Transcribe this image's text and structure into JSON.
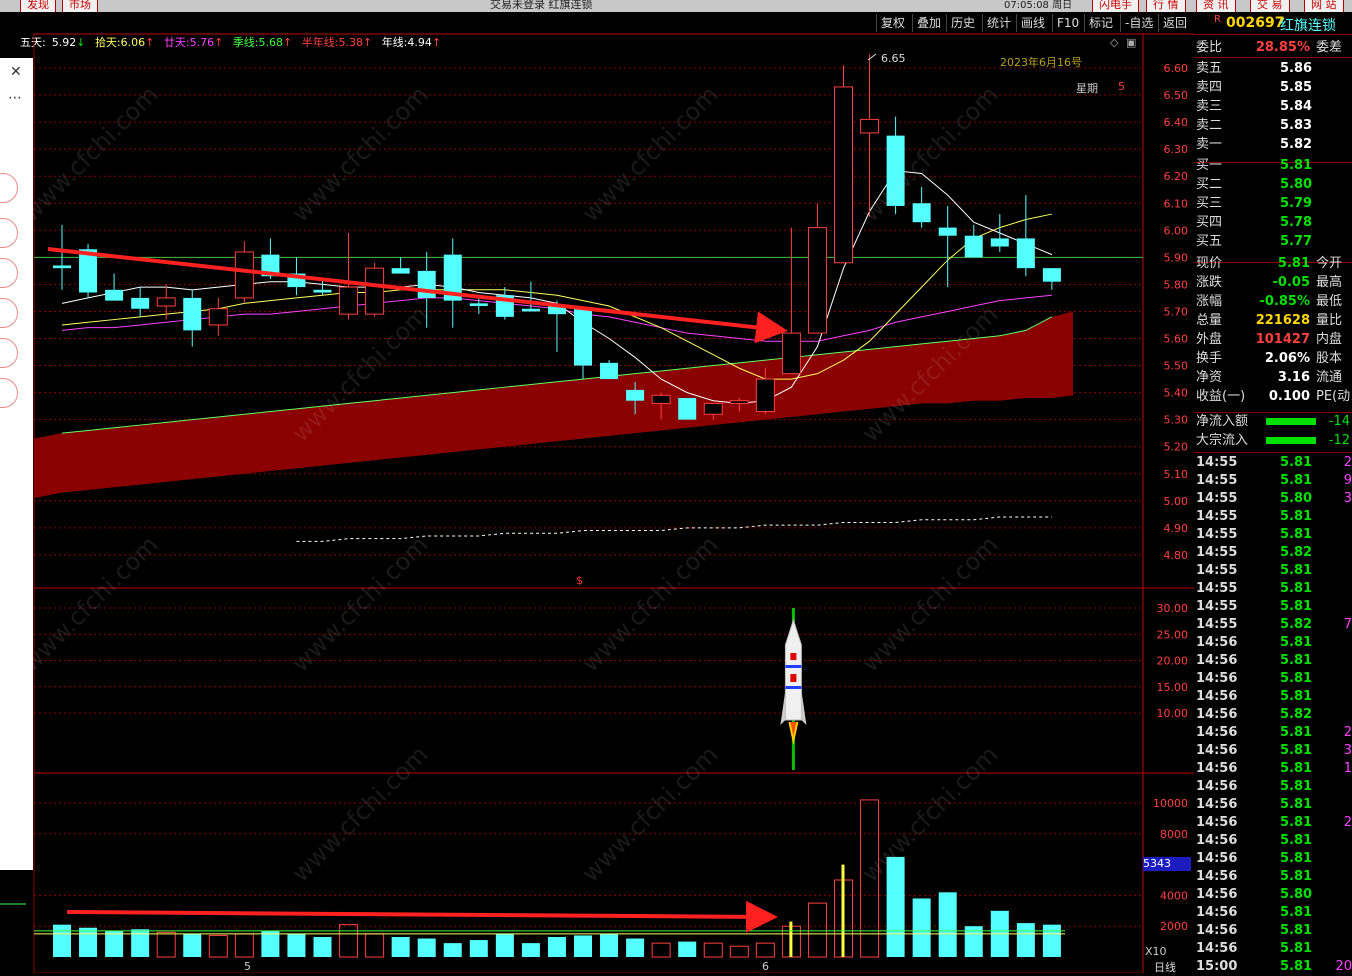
{
  "topbar": {
    "left_buttons": [
      "发现",
      "市场"
    ],
    "title": "交易未登录  红旗连锁",
    "time": "07:05:08 周日",
    "right_buttons": [
      "闪电手",
      "行 情",
      "资 讯",
      "交 易",
      "网 站"
    ]
  },
  "toolbar": {
    "buttons": [
      "复权",
      "叠加",
      "历史",
      "统计",
      "画线",
      "F10",
      "标记",
      "-自选",
      "返回"
    ]
  },
  "ma_legend": [
    {
      "label": "五天:",
      "value": "5.92",
      "arrow": "↓",
      "color": "#ffffff"
    },
    {
      "label": "拾天:",
      "value": "6.06",
      "arrow": "↑",
      "color": "#ffff60"
    },
    {
      "label": "廿天:",
      "value": "5.76",
      "arrow": "↑",
      "color": "#ff40ff"
    },
    {
      "label": "季线:",
      "value": "5.68",
      "arrow": "↑",
      "color": "#40ff40"
    },
    {
      "label": "半年线:",
      "value": "5.38",
      "arrow": "↑",
      "color": "#ff4040"
    },
    {
      "label": "年线:",
      "value": "4.94",
      "arrow": "↑",
      "color": "#ffffff"
    }
  ],
  "chart_info": {
    "date": "2023年6月16号",
    "weekday_label": "星期",
    "weekday_value": "5",
    "high_marker": "6.65",
    "dollar_marker": "$",
    "watermark": "www.cfchi.com",
    "vol_scale_badge": "5343",
    "vol_multiplier": "X10",
    "x_labels": [
      "5",
      "6"
    ],
    "period": "日线"
  },
  "price_axis": [
    "6.60",
    "6.50",
    "6.40",
    "6.30",
    "6.20",
    "6.10",
    "6.00",
    "5.90",
    "5.80",
    "5.70",
    "5.60",
    "5.50",
    "5.40",
    "5.30",
    "5.20",
    "5.10",
    "5.00",
    "4.90",
    "4.80"
  ],
  "ind_axis": [
    "30.00",
    "25.00",
    "20.00",
    "15.00",
    "10.00"
  ],
  "vol_axis": [
    "10000",
    "8000",
    "4000",
    "2000"
  ],
  "colors": {
    "up": "#ff4040",
    "down": "#54ffff",
    "grid": "#8b0000",
    "band": "#8b0000",
    "arrow": "#ff2020"
  },
  "chart_data": {
    "type": "candlestick",
    "candles": [
      {
        "o": 5.87,
        "h": 6.02,
        "l": 5.78,
        "c": 5.86
      },
      {
        "o": 5.93,
        "h": 5.95,
        "l": 5.75,
        "c": 5.77
      },
      {
        "o": 5.78,
        "h": 5.84,
        "l": 5.75,
        "c": 5.74
      },
      {
        "o": 5.75,
        "h": 5.79,
        "l": 5.68,
        "c": 5.71
      },
      {
        "o": 5.72,
        "h": 5.8,
        "l": 5.67,
        "c": 5.75
      },
      {
        "o": 5.75,
        "h": 5.78,
        "l": 5.57,
        "c": 5.63
      },
      {
        "o": 5.65,
        "h": 5.75,
        "l": 5.61,
        "c": 5.71
      },
      {
        "o": 5.75,
        "h": 5.96,
        "l": 5.73,
        "c": 5.92
      },
      {
        "o": 5.91,
        "h": 5.97,
        "l": 5.82,
        "c": 5.83
      },
      {
        "o": 5.84,
        "h": 5.9,
        "l": 5.76,
        "c": 5.79
      },
      {
        "o": 5.78,
        "h": 5.82,
        "l": 5.76,
        "c": 5.77
      },
      {
        "o": 5.69,
        "h": 5.99,
        "l": 5.67,
        "c": 5.79
      },
      {
        "o": 5.69,
        "h": 5.88,
        "l": 5.68,
        "c": 5.86
      },
      {
        "o": 5.86,
        "h": 5.9,
        "l": 5.84,
        "c": 5.84
      },
      {
        "o": 5.85,
        "h": 5.92,
        "l": 5.64,
        "c": 5.75
      },
      {
        "o": 5.91,
        "h": 5.97,
        "l": 5.64,
        "c": 5.74
      },
      {
        "o": 5.73,
        "h": 5.75,
        "l": 5.69,
        "c": 5.72
      },
      {
        "o": 5.76,
        "h": 5.79,
        "l": 5.67,
        "c": 5.68
      },
      {
        "o": 5.71,
        "h": 5.81,
        "l": 5.7,
        "c": 5.7
      },
      {
        "o": 5.72,
        "h": 5.74,
        "l": 5.55,
        "c": 5.69
      },
      {
        "o": 5.71,
        "h": 5.71,
        "l": 5.45,
        "c": 5.5
      },
      {
        "o": 5.51,
        "h": 5.52,
        "l": 5.45,
        "c": 5.45
      },
      {
        "o": 5.41,
        "h": 5.44,
        "l": 5.32,
        "c": 5.37
      },
      {
        "o": 5.36,
        "h": 5.4,
        "l": 5.3,
        "c": 5.39
      },
      {
        "o": 5.38,
        "h": 5.38,
        "l": 5.31,
        "c": 5.3
      },
      {
        "o": 5.32,
        "h": 5.36,
        "l": 5.3,
        "c": 5.36
      },
      {
        "o": 5.36,
        "h": 5.38,
        "l": 5.33,
        "c": 5.37
      },
      {
        "o": 5.33,
        "h": 5.49,
        "l": 5.32,
        "c": 5.45
      },
      {
        "o": 5.47,
        "h": 6.01,
        "l": 5.47,
        "c": 5.62
      },
      {
        "o": 5.62,
        "h": 6.1,
        "l": 5.62,
        "c": 6.01
      },
      {
        "o": 5.88,
        "h": 6.61,
        "l": 5.88,
        "c": 6.53
      },
      {
        "o": 6.36,
        "h": 6.65,
        "l": 6.05,
        "c": 6.41
      },
      {
        "o": 6.35,
        "h": 6.42,
        "l": 6.06,
        "c": 6.09
      },
      {
        "o": 6.1,
        "h": 6.16,
        "l": 6.01,
        "c": 6.03
      },
      {
        "o": 6.01,
        "h": 6.09,
        "l": 5.79,
        "c": 5.98
      },
      {
        "o": 5.98,
        "h": 6.02,
        "l": 5.9,
        "c": 5.9
      },
      {
        "o": 5.97,
        "h": 6.06,
        "l": 5.92,
        "c": 5.94
      },
      {
        "o": 5.97,
        "h": 6.13,
        "l": 5.83,
        "c": 5.86
      },
      {
        "o": 5.86,
        "h": 5.86,
        "l": 5.78,
        "c": 5.81
      }
    ],
    "ma5": [
      5.73,
      5.75,
      5.77,
      5.79,
      5.79,
      5.78,
      5.79,
      5.8,
      5.81,
      5.81,
      5.8,
      5.79,
      5.79,
      5.79,
      5.8,
      5.79,
      5.77,
      5.76,
      5.75,
      5.73,
      5.66,
      5.6,
      5.53,
      5.45,
      5.4,
      5.37,
      5.36,
      5.37,
      5.42,
      5.57,
      5.86,
      6.07,
      6.22,
      6.21,
      6.13,
      6.03,
      5.99,
      5.95,
      5.91
    ],
    "ma10": [
      5.65,
      5.66,
      5.67,
      5.68,
      5.69,
      5.7,
      5.71,
      5.73,
      5.74,
      5.75,
      5.76,
      5.77,
      5.77,
      5.78,
      5.78,
      5.78,
      5.78,
      5.78,
      5.77,
      5.76,
      5.74,
      5.72,
      5.68,
      5.64,
      5.59,
      5.54,
      5.49,
      5.45,
      5.45,
      5.47,
      5.52,
      5.59,
      5.69,
      5.79,
      5.89,
      5.97,
      6.01,
      6.04,
      6.06
    ],
    "ma20": [
      5.63,
      5.64,
      5.64,
      5.65,
      5.66,
      5.67,
      5.68,
      5.69,
      5.69,
      5.7,
      5.71,
      5.72,
      5.73,
      5.74,
      5.75,
      5.75,
      5.74,
      5.73,
      5.72,
      5.71,
      5.69,
      5.68,
      5.66,
      5.64,
      5.62,
      5.61,
      5.6,
      5.59,
      5.59,
      5.59,
      5.61,
      5.63,
      5.66,
      5.68,
      5.7,
      5.72,
      5.74,
      5.75,
      5.76
    ],
    "ma60": [
      5.25,
      5.26,
      5.27,
      5.28,
      5.29,
      5.3,
      5.31,
      5.32,
      5.33,
      5.34,
      5.35,
      5.36,
      5.37,
      5.38,
      5.39,
      5.4,
      5.41,
      5.42,
      5.43,
      5.44,
      5.45,
      5.46,
      5.47,
      5.48,
      5.49,
      5.5,
      5.51,
      5.52,
      5.53,
      5.54,
      5.55,
      5.56,
      5.57,
      5.58,
      5.59,
      5.6,
      5.61,
      5.63,
      5.68
    ],
    "ma120": [
      5.03,
      5.04,
      5.05,
      5.06,
      5.07,
      5.08,
      5.09,
      5.1,
      5.11,
      5.12,
      5.13,
      5.14,
      5.15,
      5.16,
      5.17,
      5.18,
      5.19,
      5.2,
      5.21,
      5.22,
      5.23,
      5.24,
      5.25,
      5.26,
      5.27,
      5.28,
      5.29,
      5.3,
      5.31,
      5.32,
      5.33,
      5.34,
      5.35,
      5.36,
      5.36,
      5.37,
      5.37,
      5.38,
      5.38
    ],
    "ma250_start_index": 9,
    "ma250": [
      4.85,
      4.85,
      4.86,
      4.86,
      4.86,
      4.87,
      4.87,
      4.87,
      4.88,
      4.88,
      4.88,
      4.89,
      4.89,
      4.89,
      4.89,
      4.9,
      4.9,
      4.9,
      4.91,
      4.91,
      4.91,
      4.92,
      4.92,
      4.92,
      4.93,
      4.93,
      4.93,
      4.94,
      4.94,
      4.94
    ],
    "volumes": [
      2100,
      1900,
      1700,
      1800,
      1600,
      1500,
      1400,
      1500,
      1700,
      1500,
      1300,
      2100,
      1500,
      1300,
      1200,
      900,
      1100,
      1500,
      900,
      1300,
      1400,
      1500,
      1200,
      900,
      1000,
      900,
      700,
      900,
      2000,
      3500,
      5000,
      10200,
      6500,
      3800,
      4200,
      2000,
      3000,
      2200,
      2100
    ],
    "vol_ma_baseline": 1700,
    "vol_highlight": [
      {
        "index": 28,
        "value": 2300
      },
      {
        "index": 30,
        "value": 6000
      }
    ],
    "rocket_index": 28
  },
  "quote": {
    "code": "002697",
    "name": "红旗连锁",
    "weibi_label": "委比",
    "weibi": "28.85%",
    "weicha_label": "委差",
    "asks": [
      {
        "label": "卖五",
        "price": "5.86"
      },
      {
        "label": "卖四",
        "price": "5.85"
      },
      {
        "label": "卖三",
        "price": "5.84"
      },
      {
        "label": "卖二",
        "price": "5.83"
      },
      {
        "label": "卖一",
        "price": "5.82"
      }
    ],
    "bids": [
      {
        "label": "买一",
        "price": "5.81"
      },
      {
        "label": "买二",
        "price": "5.80"
      },
      {
        "label": "买三",
        "price": "5.79"
      },
      {
        "label": "买四",
        "price": "5.78"
      },
      {
        "label": "买五",
        "price": "5.77"
      }
    ],
    "stats": [
      {
        "l1": "现价",
        "v": "5.81",
        "l2": "今开",
        "c": "g"
      },
      {
        "l1": "涨跌",
        "v": "-0.05",
        "l2": "最高",
        "c": "g"
      },
      {
        "l1": "涨幅",
        "v": "-0.85%",
        "l2": "最低",
        "c": "g"
      },
      {
        "l1": "总量",
        "v": "221628",
        "l2": "量比",
        "c": "y"
      },
      {
        "l1": "外盘",
        "v": "101427",
        "l2": "内盘",
        "c": "r"
      },
      {
        "l1": "换手",
        "v": "2.06%",
        "l2": "股本",
        "c": "w"
      },
      {
        "l1": "净资",
        "v": "3.16",
        "l2": "流通",
        "c": "w"
      },
      {
        "l1": "收益(一)",
        "v": "0.100",
        "l2": "PE(动",
        "c": "w"
      }
    ],
    "flows": [
      {
        "label": "净流入额",
        "val": "-14"
      },
      {
        "label": "大宗流入",
        "val": "-12"
      }
    ],
    "ticks": [
      {
        "t": "14:55",
        "p": "5.81",
        "v": "2"
      },
      {
        "t": "14:55",
        "p": "5.81",
        "v": "9"
      },
      {
        "t": "14:55",
        "p": "5.80",
        "v": "3"
      },
      {
        "t": "14:55",
        "p": "5.81",
        "v": ""
      },
      {
        "t": "14:55",
        "p": "5.81",
        "v": ""
      },
      {
        "t": "14:55",
        "p": "5.82",
        "v": ""
      },
      {
        "t": "14:55",
        "p": "5.81",
        "v": ""
      },
      {
        "t": "14:55",
        "p": "5.81",
        "v": ""
      },
      {
        "t": "14:55",
        "p": "5.81",
        "v": ""
      },
      {
        "t": "14:55",
        "p": "5.82",
        "v": "7"
      },
      {
        "t": "14:56",
        "p": "5.81",
        "v": ""
      },
      {
        "t": "14:56",
        "p": "5.81",
        "v": ""
      },
      {
        "t": "14:56",
        "p": "5.81",
        "v": ""
      },
      {
        "t": "14:56",
        "p": "5.81",
        "v": ""
      },
      {
        "t": "14:56",
        "p": "5.82",
        "v": ""
      },
      {
        "t": "14:56",
        "p": "5.81",
        "v": "2"
      },
      {
        "t": "14:56",
        "p": "5.81",
        "v": "3"
      },
      {
        "t": "14:56",
        "p": "5.81",
        "v": "1"
      },
      {
        "t": "14:56",
        "p": "5.81",
        "v": ""
      },
      {
        "t": "14:56",
        "p": "5.81",
        "v": ""
      },
      {
        "t": "14:56",
        "p": "5.81",
        "v": "2"
      },
      {
        "t": "14:56",
        "p": "5.81",
        "v": ""
      },
      {
        "t": "14:56",
        "p": "5.81",
        "v": ""
      },
      {
        "t": "14:56",
        "p": "5.81",
        "v": ""
      },
      {
        "t": "14:56",
        "p": "5.80",
        "v": ""
      },
      {
        "t": "14:56",
        "p": "5.81",
        "v": ""
      },
      {
        "t": "14:56",
        "p": "5.81",
        "v": ""
      },
      {
        "t": "14:56",
        "p": "5.81",
        "v": ""
      },
      {
        "t": "15:00",
        "p": "5.81",
        "v": "20"
      }
    ]
  }
}
